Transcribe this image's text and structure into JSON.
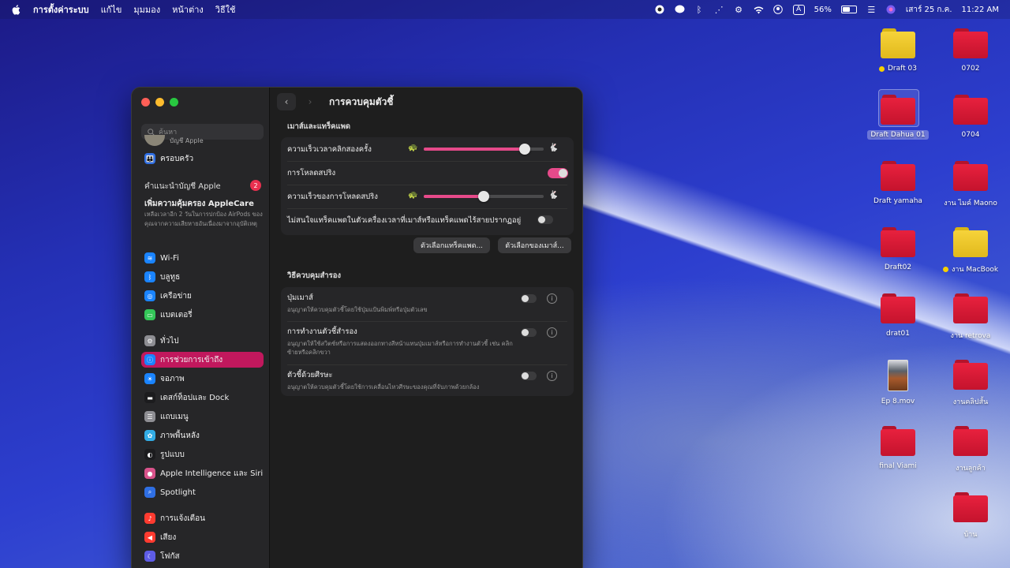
{
  "menubar": {
    "app": "การตั้งค่าระบบ",
    "menus": [
      "แก้ไข",
      "มุมมอง",
      "หน้าต่าง",
      "วิธีใช้"
    ],
    "battery": "56%",
    "battery_level": 0.56,
    "date": "เสาร์ 25 ก.ค.",
    "time": "11:22 AM"
  },
  "desktop": {
    "items": [
      {
        "label": "Draft 03",
        "kind": "folder-yellow",
        "tag": "#f5d000"
      },
      {
        "label": "0702",
        "kind": "folder-red"
      },
      {
        "label": "Draft Dahua 01",
        "kind": "folder-red",
        "selected": true
      },
      {
        "label": "0704",
        "kind": "folder-red"
      },
      {
        "label": "Draft yamaha",
        "kind": "folder-red"
      },
      {
        "label": "งาน ไมค์ Maono",
        "kind": "folder-red"
      },
      {
        "label": "Draft02",
        "kind": "folder-red"
      },
      {
        "label": "งาน MacBook",
        "kind": "folder-yellow",
        "tag": "#f5d000"
      },
      {
        "label": "drat01",
        "kind": "folder-red"
      },
      {
        "label": "งาน retrova",
        "kind": "folder-red"
      },
      {
        "label": "Ep 8.mov",
        "kind": "video"
      },
      {
        "label": "งานคลิปสั้น",
        "kind": "folder-red"
      },
      {
        "label": "final Viami",
        "kind": "folder-red"
      },
      {
        "label": "งานลูกค้า",
        "kind": "folder-red"
      },
      {
        "label": "บ้าน",
        "kind": "folder-red"
      }
    ]
  },
  "window": {
    "title": "การควบคุมตัวชี้",
    "search_placeholder": "ค้นหา",
    "account_label": "บัญชี Apple",
    "family": "ครอบครัว",
    "suggest_heading": "คำแนะนำบัญชี Apple",
    "suggest_badge": "2",
    "applecare_title": "เพิ่มความคุ้มครอง AppleCare",
    "applecare_desc": "เหลือเวลาอีก 2 วันในการปกป้อง AirPods ของคุณจากความเสียหายอันเนื่องมาจากอุบัติเหตุ",
    "sidebar": [
      {
        "label": "Wi-Fi",
        "icon": "wifi-icon",
        "color": "#1a84ff"
      },
      {
        "label": "บลูทูธ",
        "icon": "bluetooth-icon",
        "color": "#1a84ff"
      },
      {
        "label": "เครือข่าย",
        "icon": "globe-icon",
        "color": "#1a84ff"
      },
      {
        "label": "แบตเตอรี่",
        "icon": "battery-icon",
        "color": "#34c759"
      },
      {
        "label": "ทั่วไป",
        "icon": "gear-icon",
        "color": "#8e8e93"
      },
      {
        "label": "การช่วยการเข้าถึง",
        "icon": "accessibility-icon",
        "color": "#1a84ff",
        "active": true
      },
      {
        "label": "จอภาพ",
        "icon": "sun-icon",
        "color": "#1a84ff"
      },
      {
        "label": "เดสก์ท็อปและ Dock",
        "icon": "dock-icon",
        "color": "#1c1c1e"
      },
      {
        "label": "แถบเมนู",
        "icon": "menubar-icon",
        "color": "#8e8e93"
      },
      {
        "label": "ภาพพื้นหลัง",
        "icon": "wallpaper-icon",
        "color": "#32ade6"
      },
      {
        "label": "รูปแบบ",
        "icon": "appearance-icon",
        "color": "#1c1c1e"
      },
      {
        "label": "Apple Intelligence และ Siri",
        "icon": "siri-icon",
        "color": "#d9538b"
      },
      {
        "label": "Spotlight",
        "icon": "search-icon",
        "color": "#2f6fe4"
      },
      {
        "label": "การแจ้งเตือน",
        "icon": "bell-icon",
        "color": "#ff3b30"
      },
      {
        "label": "เสียง",
        "icon": "speaker-icon",
        "color": "#ff3b30"
      },
      {
        "label": "โฟกัส",
        "icon": "moon-icon",
        "color": "#5e5ce6"
      }
    ],
    "section1": {
      "title": "เมาส์และแทร็คแพด",
      "double_click_label": "ความเร็วเวลาคลิกสองครั้ง",
      "double_click_value": 0.84,
      "spring_label": "การโหลดสปริง",
      "spring_on": true,
      "spring_speed_label": "ความเร็วของการโหลดสปริง",
      "spring_speed_value": 0.5,
      "ignore_trackpad_label": "ไม่สนใจแทร็คแพดในตัวเครื่องเวลาที่เมาส์หรือแทร็คแพดไร้สายปรากฏอยู่",
      "ignore_trackpad_on": false,
      "trackpad_btn": "ตัวเลือกแทร็คแพด...",
      "mouse_btn": "ตัวเลือกของเมาส์..."
    },
    "section2": {
      "title": "วิธีควบคุมสำรอง",
      "items": [
        {
          "label": "ปุ่มเมาส์",
          "desc": "อนุญาตให้ควบคุมตัวชี้โดยใช้ปุ่มแป้นพิมพ์หรือปุ่มตัวเลข",
          "on": false
        },
        {
          "label": "การทำงานตัวชี้สำรอง",
          "desc": "อนุญาตให้ใช้สวิตช์หรือการแสดงออกทางสีหน้าแทนปุ่มเมาส์หรือการทำงานตัวชี้ เช่น คลิกซ้ายหรือคลิกขวา",
          "on": false
        },
        {
          "label": "ตัวชี้ด้วยศีรษะ",
          "desc": "อนุญาตให้ควบคุมตัวชี้โดยใช้การเคลื่อนไหวศีรษะของคุณที่จับภาพด้วยกล้อง",
          "on": false
        }
      ]
    },
    "help": "?"
  }
}
